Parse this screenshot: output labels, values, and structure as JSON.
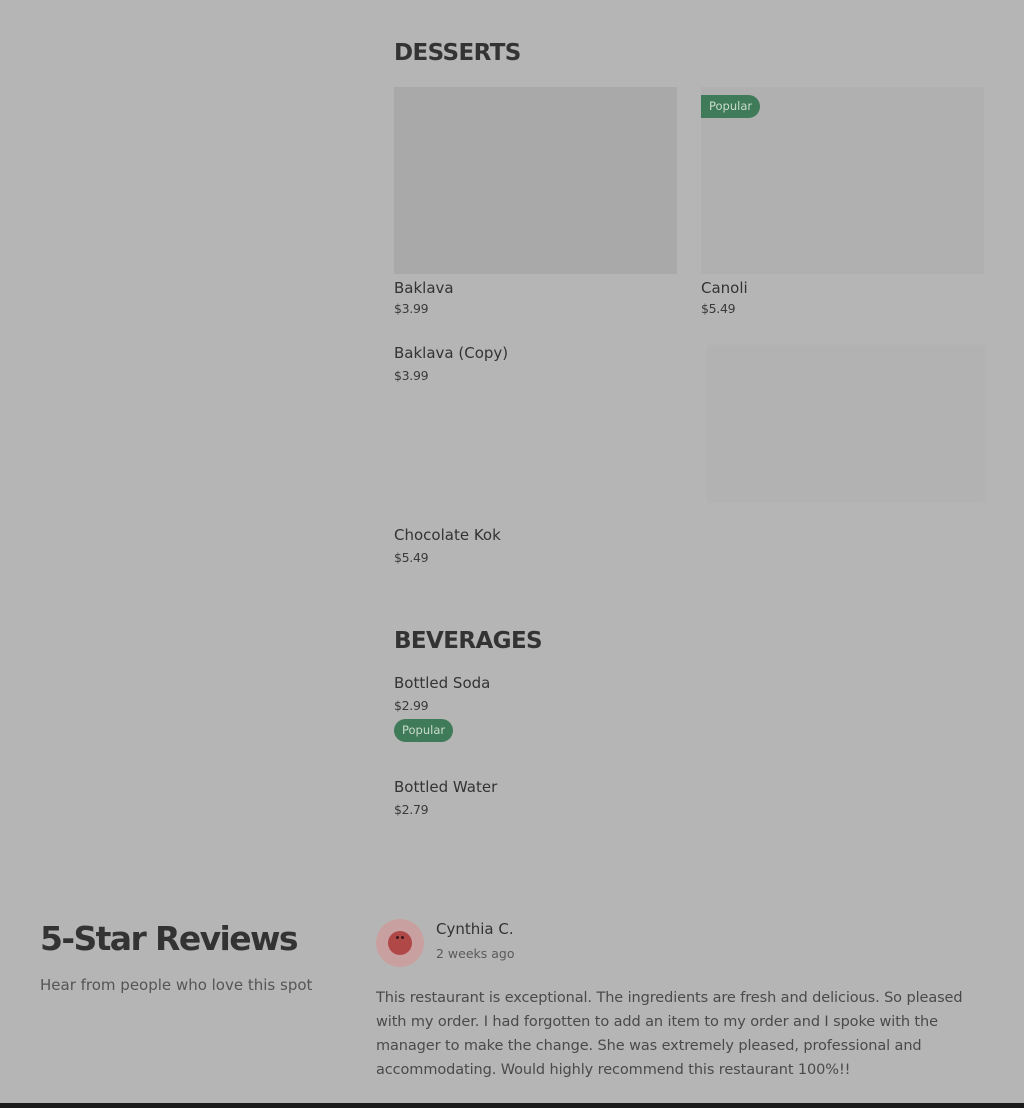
{
  "desserts": {
    "title": "DESSERTS",
    "items": [
      {
        "name": "Baklava",
        "price": "$3.99"
      },
      {
        "name": "Canoli",
        "price": "$5.49",
        "badge": "Popular"
      },
      {
        "name": "Baklava (Copy)",
        "price": "$3.99"
      },
      {
        "name": "Chocolate Kok",
        "price": "$5.49"
      }
    ]
  },
  "beverages": {
    "title": "BEVERAGES",
    "items": [
      {
        "name": "Bottled Soda",
        "price": "$2.99",
        "badge": "Popular"
      },
      {
        "name": "Bottled Water",
        "price": "$2.79"
      }
    ]
  },
  "reviews": {
    "title": "5-Star Reviews",
    "subtitle": "Hear from people who love this spot",
    "review": {
      "author": "Cynthia C.",
      "date": "2 weeks ago",
      "text": "This restaurant is exceptional. The ingredients are fresh and delicious. So pleased with my order. I had forgotten to add an item to my order and I spoke with the manager to make the change. She was extremely pleased, professional and accommodating. Would highly recommend this restaurant 100%!!"
    }
  },
  "colors": {
    "background": "#b5b5b5",
    "badge": "#3f7a59",
    "text": "#333333"
  }
}
